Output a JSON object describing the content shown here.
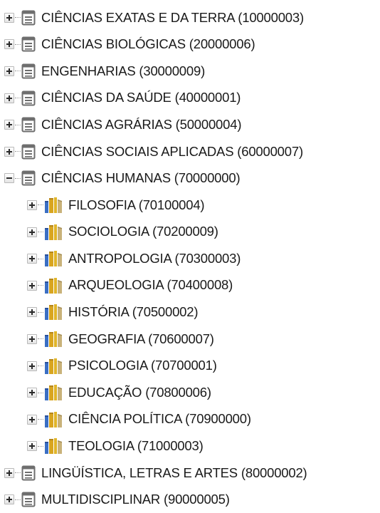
{
  "tree": {
    "roots": [
      {
        "label": "CIÊNCIAS EXATAS E DA TERRA (10000003)",
        "icon": "document-list-icon",
        "expanded": false
      },
      {
        "label": "CIÊNCIAS BIOLÓGICAS (20000006)",
        "icon": "document-list-icon",
        "expanded": false
      },
      {
        "label": "ENGENHARIAS (30000009)",
        "icon": "document-list-icon",
        "expanded": false
      },
      {
        "label": "CIÊNCIAS DA SAÚDE (40000001)",
        "icon": "document-list-icon",
        "expanded": false
      },
      {
        "label": "CIÊNCIAS AGRÁRIAS (50000004)",
        "icon": "document-list-icon",
        "expanded": false
      },
      {
        "label": "CIÊNCIAS SOCIAIS APLICADAS (60000007)",
        "icon": "document-list-icon",
        "expanded": false
      },
      {
        "label": "CIÊNCIAS HUMANAS (70000000)",
        "icon": "document-list-icon",
        "expanded": true,
        "children": [
          {
            "label": "FILOSOFIA (70100004)",
            "icon": "books-icon"
          },
          {
            "label": "SOCIOLOGIA (70200009)",
            "icon": "books-icon"
          },
          {
            "label": "ANTROPOLOGIA (70300003)",
            "icon": "books-icon"
          },
          {
            "label": "ARQUEOLOGIA (70400008)",
            "icon": "books-icon"
          },
          {
            "label": "HISTÓRIA (70500002)",
            "icon": "books-icon"
          },
          {
            "label": "GEOGRAFIA (70600007)",
            "icon": "books-icon"
          },
          {
            "label": "PSICOLOGIA (70700001)",
            "icon": "books-icon"
          },
          {
            "label": "EDUCAÇÃO (70800006)",
            "icon": "books-icon"
          },
          {
            "label": "CIÊNCIA POLÍTICA (70900000)",
            "icon": "books-icon"
          },
          {
            "label": "TEOLOGIA (71000003)",
            "icon": "books-icon"
          }
        ]
      },
      {
        "label": "LINGÜÍSTICA, LETRAS E ARTES (80000002)",
        "icon": "document-list-icon",
        "expanded": false
      },
      {
        "label": "MULTIDISCIPLINAR (90000005)",
        "icon": "document-list-icon",
        "expanded": false
      }
    ]
  },
  "colors": {
    "icon_gray": "#6e6e6e",
    "book_blue": "#3b6fc4",
    "book_gold": "#d9a520",
    "book_tan": "#c9b27a"
  }
}
